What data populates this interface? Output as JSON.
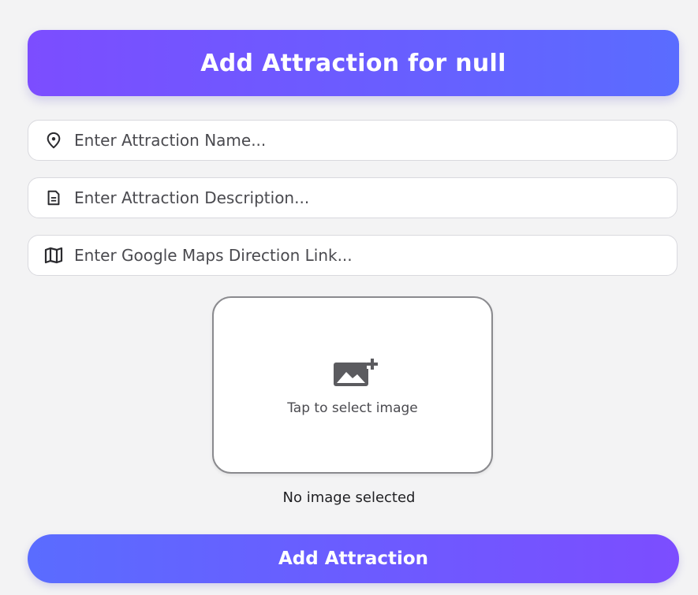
{
  "header": {
    "title": "Add Attraction for null"
  },
  "form": {
    "name_field": {
      "placeholder": "Enter Attraction Name...",
      "icon": "location-pin-icon"
    },
    "description_field": {
      "placeholder": "Enter Attraction Description...",
      "icon": "document-icon"
    },
    "maps_field": {
      "placeholder": "Enter Google Maps Direction Link...",
      "icon": "map-icon"
    },
    "image_picker": {
      "label": "Tap to select image",
      "icon": "add-photo-icon"
    },
    "image_status": "No image selected",
    "submit_label": "Add Attraction"
  },
  "colors": {
    "gradient_start": "#7c4dff",
    "gradient_end": "#5a6cff",
    "background": "#f3f3f4",
    "field_border": "#d9d9de"
  }
}
